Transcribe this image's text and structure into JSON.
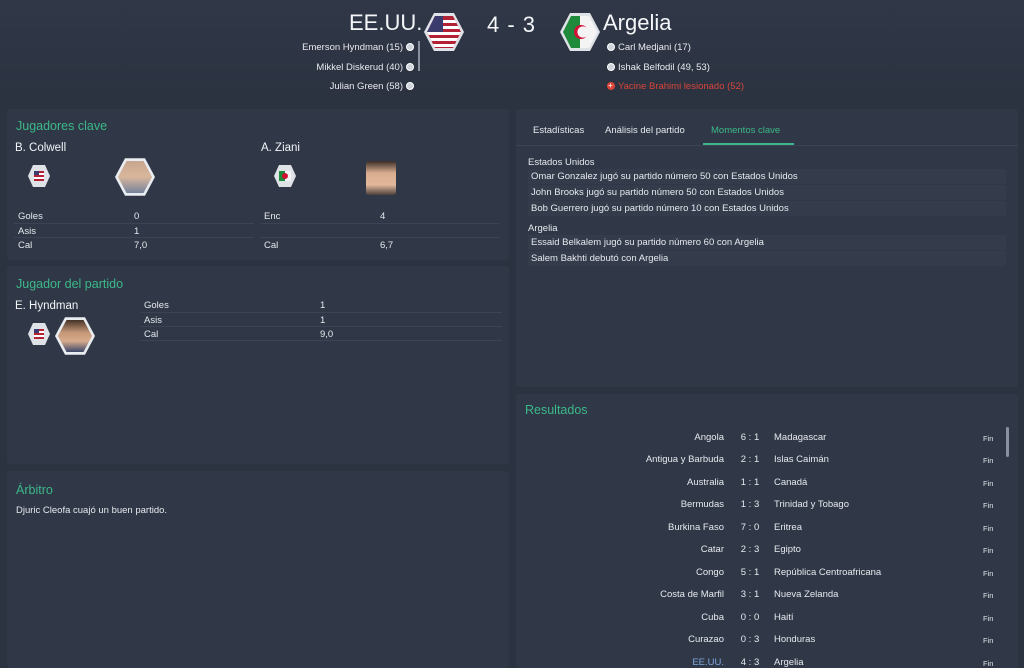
{
  "header": {
    "home_team": "EE.UU.",
    "away_team": "Argelia",
    "score": "4 - 3",
    "home_scorers": [
      "Emerson Hyndman (15)",
      "Mikkel Diskerud (40)",
      "Julian Green (58)"
    ],
    "away_events": [
      {
        "text": "Carl Medjani (17)",
        "type": "goal"
      },
      {
        "text": "Ishak Belfodil (49, 53)",
        "type": "goal"
      },
      {
        "text": "Yacine Brahimi lesionado (52)",
        "type": "injury"
      }
    ],
    "colors": {
      "accent": "#3bb889",
      "injury": "#d9453a",
      "highlight": "#7fa6e0"
    }
  },
  "key_players": {
    "title": "Jugadores clave",
    "home_player": {
      "name": "B. Colwell",
      "stats": [
        {
          "label": "Goles",
          "value": "0"
        },
        {
          "label": "Asis",
          "value": "1"
        },
        {
          "label": "Cal",
          "value": "7,0"
        }
      ]
    },
    "away_player": {
      "name": "A. Ziani",
      "stats": [
        {
          "label": "Enc",
          "value": "4"
        },
        {
          "label": "Cal",
          "value": "6,7"
        }
      ]
    }
  },
  "potm": {
    "title": "Jugador del partido",
    "name": "E. Hyndman",
    "stats": [
      {
        "label": "Goles",
        "value": "1"
      },
      {
        "label": "Asis",
        "value": "1"
      },
      {
        "label": "Cal",
        "value": "9,0"
      }
    ]
  },
  "referee": {
    "title": "Árbitro",
    "text": "Djuric Cleofa cuajó un buen partido."
  },
  "tabs": [
    "Estadísticas",
    "Análisis del partido",
    "Momentos clave"
  ],
  "active_tab": "Momentos clave",
  "moments": [
    {
      "team": "Estados Unidos",
      "items": [
        "Omar Gonzalez jugó su partido número 50 con Estados Unidos",
        "John Brooks jugó su partido número 50 con Estados Unidos",
        "Bob Guerrero jugó su partido número 10 con Estados Unidos"
      ]
    },
    {
      "team": "Argelia",
      "items": [
        "Essaid Belkalem jugó su partido número 60 con Argelia",
        "Salem Bakhti debutó con Argelia"
      ]
    }
  ],
  "results": {
    "title": "Resultados",
    "rows": [
      {
        "home": "Angola",
        "score": "6 : 1",
        "away": "Madagascar",
        "status": "Fin"
      },
      {
        "home": "Antigua y Barbuda",
        "score": "2 : 1",
        "away": "Islas Caimán",
        "status": "Fin"
      },
      {
        "home": "Australia",
        "score": "1 : 1",
        "away": "Canadá",
        "status": "Fin"
      },
      {
        "home": "Bermudas",
        "score": "1 : 3",
        "away": "Trinidad y Tobago",
        "status": "Fin"
      },
      {
        "home": "Burkina Faso",
        "score": "7 : 0",
        "away": "Eritrea",
        "status": "Fin"
      },
      {
        "home": "Catar",
        "score": "2 : 3",
        "away": "Egipto",
        "status": "Fin"
      },
      {
        "home": "Congo",
        "score": "5 : 1",
        "away": "República Centroafricana",
        "status": "Fin"
      },
      {
        "home": "Costa de Marfil",
        "score": "3 : 1",
        "away": "Nueva Zelanda",
        "status": "Fin"
      },
      {
        "home": "Cuba",
        "score": "0 : 0",
        "away": "Haití",
        "status": "Fin"
      },
      {
        "home": "Curazao",
        "score": "0 : 3",
        "away": "Honduras",
        "status": "Fin"
      },
      {
        "home": "EE.UU.",
        "score": "4 : 3",
        "away": "Argelia",
        "status": "Fin"
      }
    ]
  }
}
